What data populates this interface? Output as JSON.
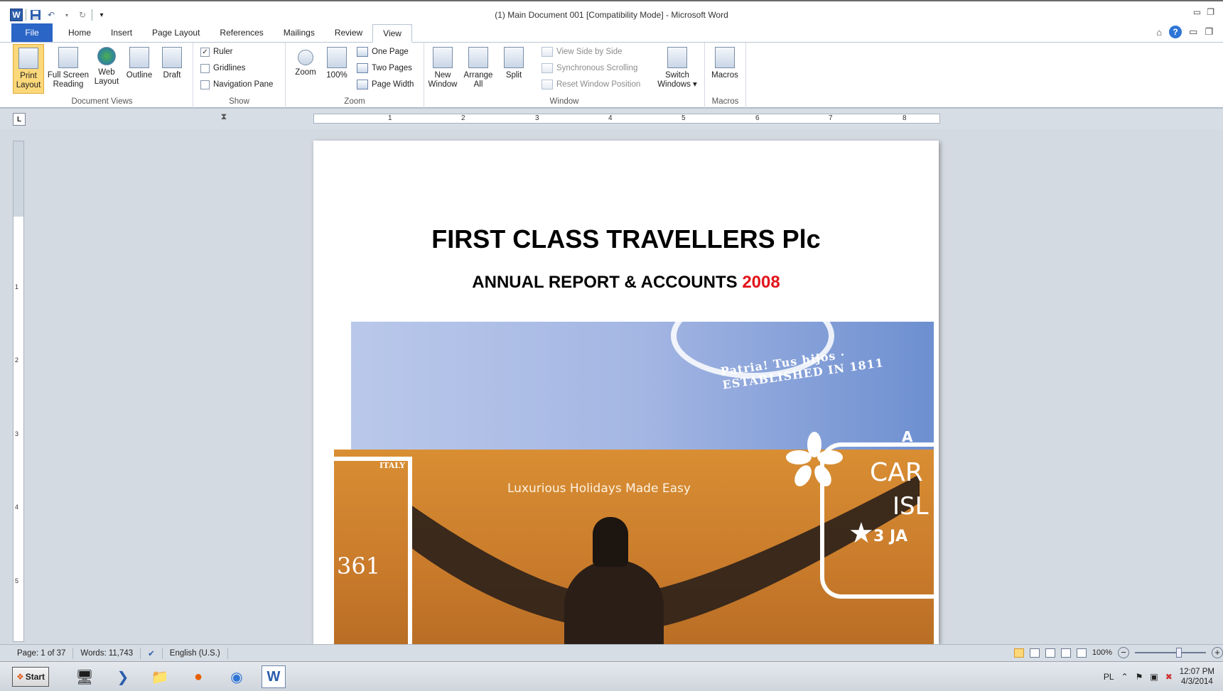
{
  "window": {
    "title": "(1) Main Document 001 [Compatibility Mode]  -  Microsoft Word",
    "app_icon": "word-icon"
  },
  "tabs": [
    {
      "label": "File"
    },
    {
      "label": "Home"
    },
    {
      "label": "Insert"
    },
    {
      "label": "Page Layout"
    },
    {
      "label": "References"
    },
    {
      "label": "Mailings"
    },
    {
      "label": "Review"
    },
    {
      "label": "View"
    }
  ],
  "ribbon": {
    "document_views": {
      "label": "Document Views",
      "print_layout": "Print Layout",
      "full_screen_reading": "Full Screen Reading",
      "web_layout": "Web Layout",
      "outline": "Outline",
      "draft": "Draft"
    },
    "show": {
      "label": "Show",
      "ruler": "Ruler",
      "ruler_checked": "✓",
      "gridlines": "Gridlines",
      "navigation_pane": "Navigation Pane"
    },
    "zoom": {
      "label": "Zoom",
      "zoom": "Zoom",
      "hundred": "100%",
      "one_page": "One Page",
      "two_pages": "Two Pages",
      "page_width": "Page Width"
    },
    "window": {
      "label": "Window",
      "new_window": "New Window",
      "arrange_all": "Arrange All",
      "split": "Split",
      "view_side_by_side": "View Side by Side",
      "synchronous_scrolling": "Synchronous Scrolling",
      "reset_window_position": "Reset Window Position",
      "switch_windows": "Switch Windows ▾"
    },
    "macros": {
      "label": "Macros",
      "macros": "Macros"
    }
  },
  "ruler": {
    "tab_selector": "L",
    "numbers": [
      "1",
      "2",
      "3",
      "4",
      "5",
      "6",
      "7",
      "8"
    ],
    "vertical_numbers": [
      "1",
      "2",
      "3",
      "4",
      "5"
    ]
  },
  "document": {
    "title": "FIRST CLASS TRAVELLERS Plc",
    "subtitle": "ANNUAL REPORT & ACCOUNTS",
    "year": "2008",
    "cover": {
      "tagline": "Luxurious Holidays Made Easy",
      "stamp_top_text": "Patria! Tus hijos · ESTABLISHED IN 1811",
      "stamp_italy": "ITALY",
      "stamp_361": "361",
      "stamp_right_a": "A",
      "stamp_right_car": "CAR",
      "stamp_right_isl": "ISL",
      "stamp_right_3ja": "3  JA"
    }
  },
  "status": {
    "page": "Page: 1 of 37",
    "words": "Words: 11,743",
    "language": "English (U.S.)",
    "zoom": "100%"
  },
  "taskbar": {
    "start": "Start",
    "lang": "PL",
    "time": "12:07 PM",
    "date": "4/3/2014"
  }
}
